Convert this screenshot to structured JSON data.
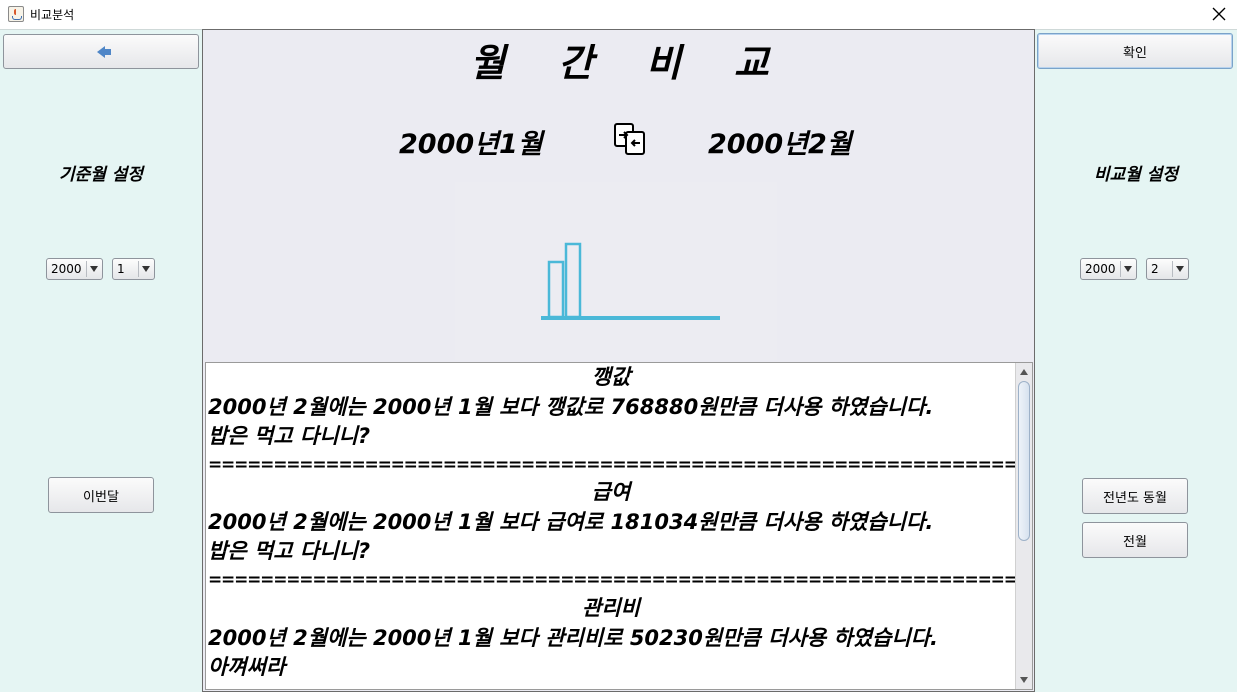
{
  "window": {
    "title": "비교분석"
  },
  "left_panel": {
    "section_label": "기준월 설정",
    "year_select": "2000",
    "month_select": "1",
    "this_month_button": "이번달"
  },
  "right_panel": {
    "confirm_button": "확인",
    "section_label": "비교월 설정",
    "year_select": "2000",
    "month_select": "2",
    "prev_year_same_month_button": "전년도 동월",
    "prev_month_button": "전월"
  },
  "center": {
    "title": "월    간    비    교",
    "base_month": "2000년1월",
    "compare_month": "2000년2월"
  },
  "chart_data": {
    "type": "bar",
    "categories": [
      "2000년1월",
      "2000년2월"
    ],
    "values": [
      55,
      73
    ],
    "bar_color": "#4ab8d8",
    "axis_color": "#4ab8d8",
    "ylim": [
      0,
      100
    ],
    "grid": false
  },
  "report": {
    "items": [
      {
        "category": "깽값",
        "sentence": "2000년 2월에는 2000년 1월 보다 깽값로 768880원만큼 더사용 하였습니다.",
        "comment": " 밥은 먹고 다니니?",
        "separator": "================================================================"
      },
      {
        "category": "급여",
        "sentence": "2000년 2월에는 2000년 1월 보다 급여로 181034원만큼 더사용 하였습니다.",
        "comment": " 밥은 먹고 다니니?",
        "separator": "================================================================"
      },
      {
        "category": "관리비",
        "sentence": "2000년 2월에는 2000년 1월 보다 관리비로 50230원만큼 더사용 하였습니다.",
        "comment": "아껴써라"
      }
    ]
  },
  "colors": {
    "side_panel_bg": "#e5f5f3",
    "center_bg": "#ebebf2",
    "back_arrow": "#4f86c7"
  },
  "icons": {
    "back": "left-arrow-icon",
    "swap": "swap-icon",
    "close": "close-icon"
  }
}
